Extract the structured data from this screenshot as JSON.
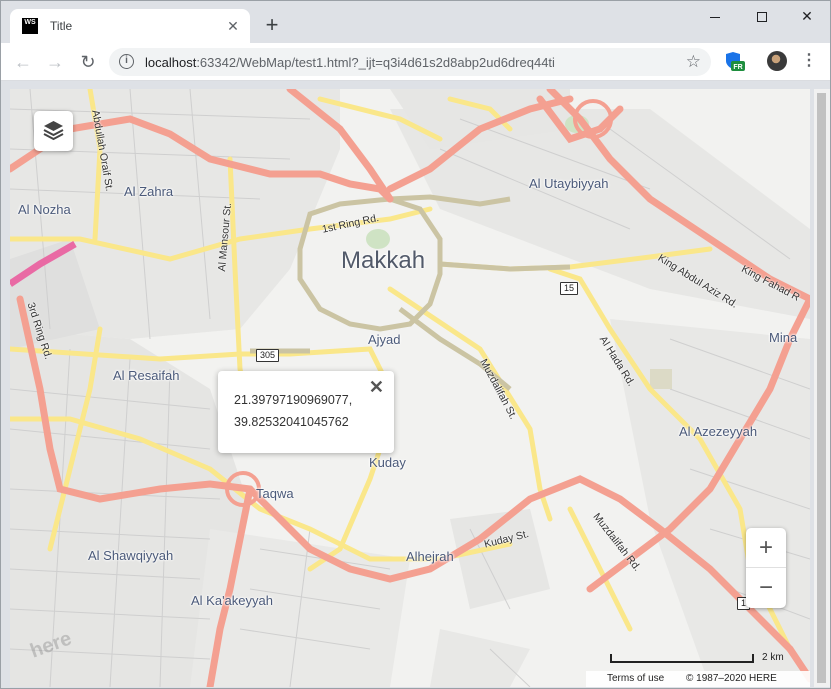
{
  "browser": {
    "tab_title": "Title",
    "tab_favicon_text": "WS",
    "url_host": "localhost",
    "url_rest": ":63342/WebMap/test1.html?_ijt=q3i4d61s2d8abp2ud6dreq44ti",
    "extension_badge": "FR"
  },
  "map": {
    "places": {
      "makkah": "Makkah",
      "al_zahra": "Al Zahra",
      "al_nozha": "Al Nozha",
      "al_utaybiyyah": "Al Utaybiyyah",
      "ajyad": "Ajyad",
      "al_resaifah": "Al Resaifah",
      "kuday": "Kuday",
      "taqwa": "Taqwa",
      "al_azezeyyah": "Al Azezeyyah",
      "mina": "Mina",
      "al_shawqiyyah": "Al Shawqiyyah",
      "alhejrah": "Alhejrah",
      "al_kaakeyyah": "Al Ka'akeyyah"
    },
    "roads": {
      "abdullah_oraif": "Abdullah Oraif St.",
      "al_mansour": "Al Mansour St.",
      "first_ring": "1st Ring Rd.",
      "third_ring": "3rd Ring Rd.",
      "king_abdul_aziz": "King Abdul Aziz Rd.",
      "king_fahad": "King Fahad R",
      "al_hada": "Al Hada Rd.",
      "muzdalifah_st": "Muzdalifah St.",
      "kuday_st": "Kuday St.",
      "muzdalifah_rd": "Muzdalifah Rd."
    },
    "shields": {
      "s15": "15",
      "s305": "305",
      "s1": "1"
    },
    "popup": {
      "lat": "21.39797190969077,",
      "lng": "39.82532041045762",
      "close_symbol": "✕"
    },
    "zoom_in": "+",
    "zoom_out": "−",
    "scale_label": "2 km",
    "attribution_terms": "Terms of use",
    "attribution_copyright": "© 1987–2020 HERE",
    "logo_text": "here"
  },
  "colors": {
    "background": "#f2f2f0",
    "major_road": "#f4a091",
    "secondary_road": "#fae78a",
    "ring_road": "#c9c3a6",
    "highway_pink": "#e96aa4",
    "minor_road": "#d0d0d0"
  }
}
